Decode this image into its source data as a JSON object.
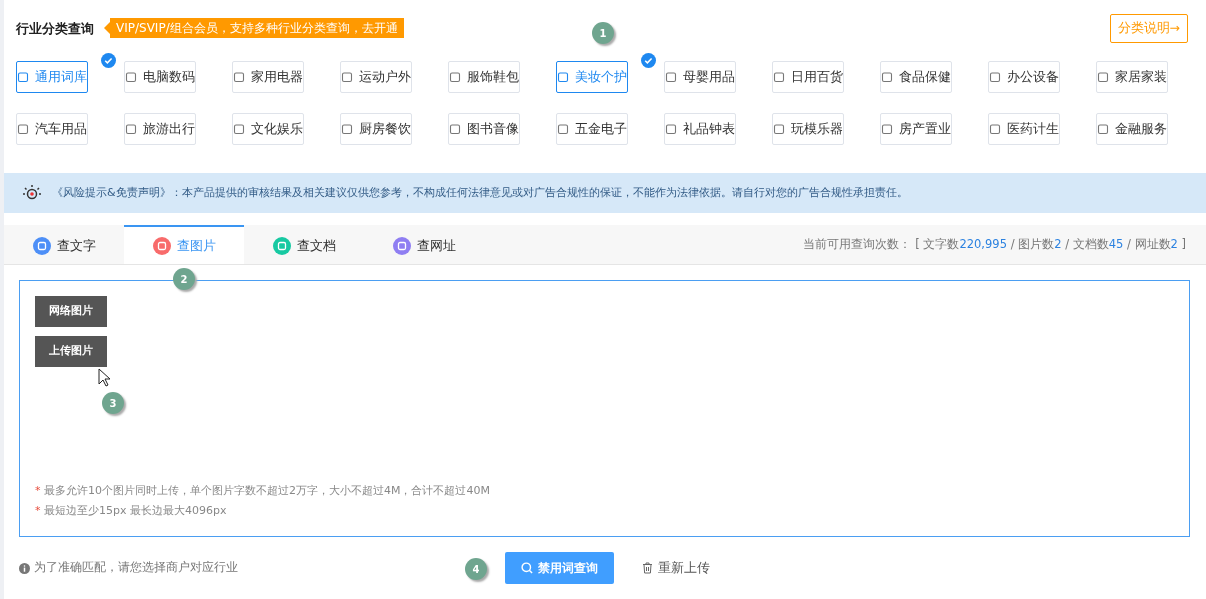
{
  "header": {
    "title": "行业分类查询",
    "promo": "VIP/SVIP/组合会员，支持多种行业分类查询，",
    "promo_link": "去开通",
    "help_button": "分类说明→"
  },
  "categories": [
    {
      "label": "通用词库",
      "selected": true
    },
    {
      "label": "电脑数码",
      "selected": false
    },
    {
      "label": "家用电器",
      "selected": false
    },
    {
      "label": "运动户外",
      "selected": false
    },
    {
      "label": "服饰鞋包",
      "selected": false
    },
    {
      "label": "美妆个护",
      "selected": true
    },
    {
      "label": "母婴用品",
      "selected": false
    },
    {
      "label": "日用百货",
      "selected": false
    },
    {
      "label": "食品保健",
      "selected": false
    },
    {
      "label": "办公设备",
      "selected": false
    },
    {
      "label": "家居家装",
      "selected": false
    },
    {
      "label": "汽车用品",
      "selected": false
    },
    {
      "label": "旅游出行",
      "selected": false
    },
    {
      "label": "文化娱乐",
      "selected": false
    },
    {
      "label": "厨房餐饮",
      "selected": false
    },
    {
      "label": "图书音像",
      "selected": false
    },
    {
      "label": "五金电子",
      "selected": false
    },
    {
      "label": "礼品钟表",
      "selected": false
    },
    {
      "label": "玩模乐器",
      "selected": false
    },
    {
      "label": "房产置业",
      "selected": false
    },
    {
      "label": "医药计生",
      "selected": false
    },
    {
      "label": "金融服务",
      "selected": false
    }
  ],
  "notice": "《风险提示&免责声明》：本产品提供的审核结果及相关建议仅供您参考，不构成任何法律意见或对广告合规性的保证，不能作为法律依据。请自行对您的广告合规性承担责任。",
  "tabs": [
    {
      "label": "查文字",
      "selected": false,
      "color": "#4d8ff7"
    },
    {
      "label": "查图片",
      "selected": true,
      "color": "#f86b6b"
    },
    {
      "label": "查文档",
      "selected": false,
      "color": "#17c9a2"
    },
    {
      "label": "查网址",
      "selected": false,
      "color": "#8f7ef2"
    }
  ],
  "quota": {
    "label": "当前可用查询次数：",
    "open": "[",
    "close": "]",
    "separator": "/",
    "items": [
      {
        "name": "文字数",
        "value": "220,995"
      },
      {
        "name": "图片数",
        "value": "2"
      },
      {
        "name": "文档数",
        "value": "45"
      },
      {
        "name": "网址数",
        "value": "2"
      }
    ]
  },
  "upload": {
    "buttons": [
      "网络图片",
      "上传图片"
    ],
    "notes": [
      "最多允许10个图片同时上传，单个图片字数不超过2万字，大小不超过4M，合计不超过40M",
      "最短边至少15px 最长边最大4096px"
    ],
    "note_mark": "*"
  },
  "footer": {
    "hint": "为了准确匹配，请您选择商户对应行业",
    "search_button": "禁用词查询",
    "reupload_button": "重新上传"
  },
  "markers": [
    "1",
    "2",
    "3",
    "4"
  ]
}
